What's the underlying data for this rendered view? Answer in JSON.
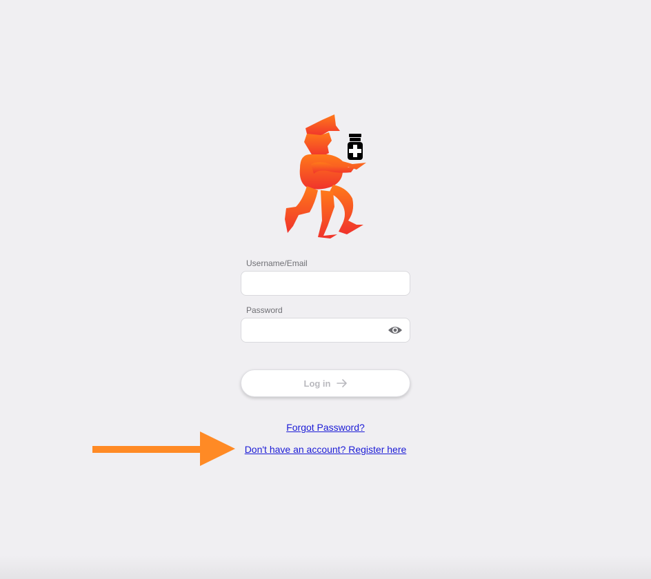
{
  "login_form": {
    "username_label": "Username/Email",
    "username_value": "",
    "password_label": "Password",
    "password_value": "",
    "login_label": "Log in",
    "forgot_password_label": "Forgot Password?",
    "register_label": "Don't have an account? Register here"
  },
  "icons": {
    "logo": "running-pharmacist-logo",
    "password_toggle": "eye-icon",
    "login_arrow": "arrow-right-icon",
    "annotation": "orange-arrow-annotation"
  },
  "colors": {
    "background": "#f0eff2",
    "logo_top": "#ff7a1a",
    "logo_bottom": "#f0332c",
    "link": "#1b1bd6",
    "annotation_arrow": "#ff8a25",
    "login_text": "#b9b9be"
  }
}
